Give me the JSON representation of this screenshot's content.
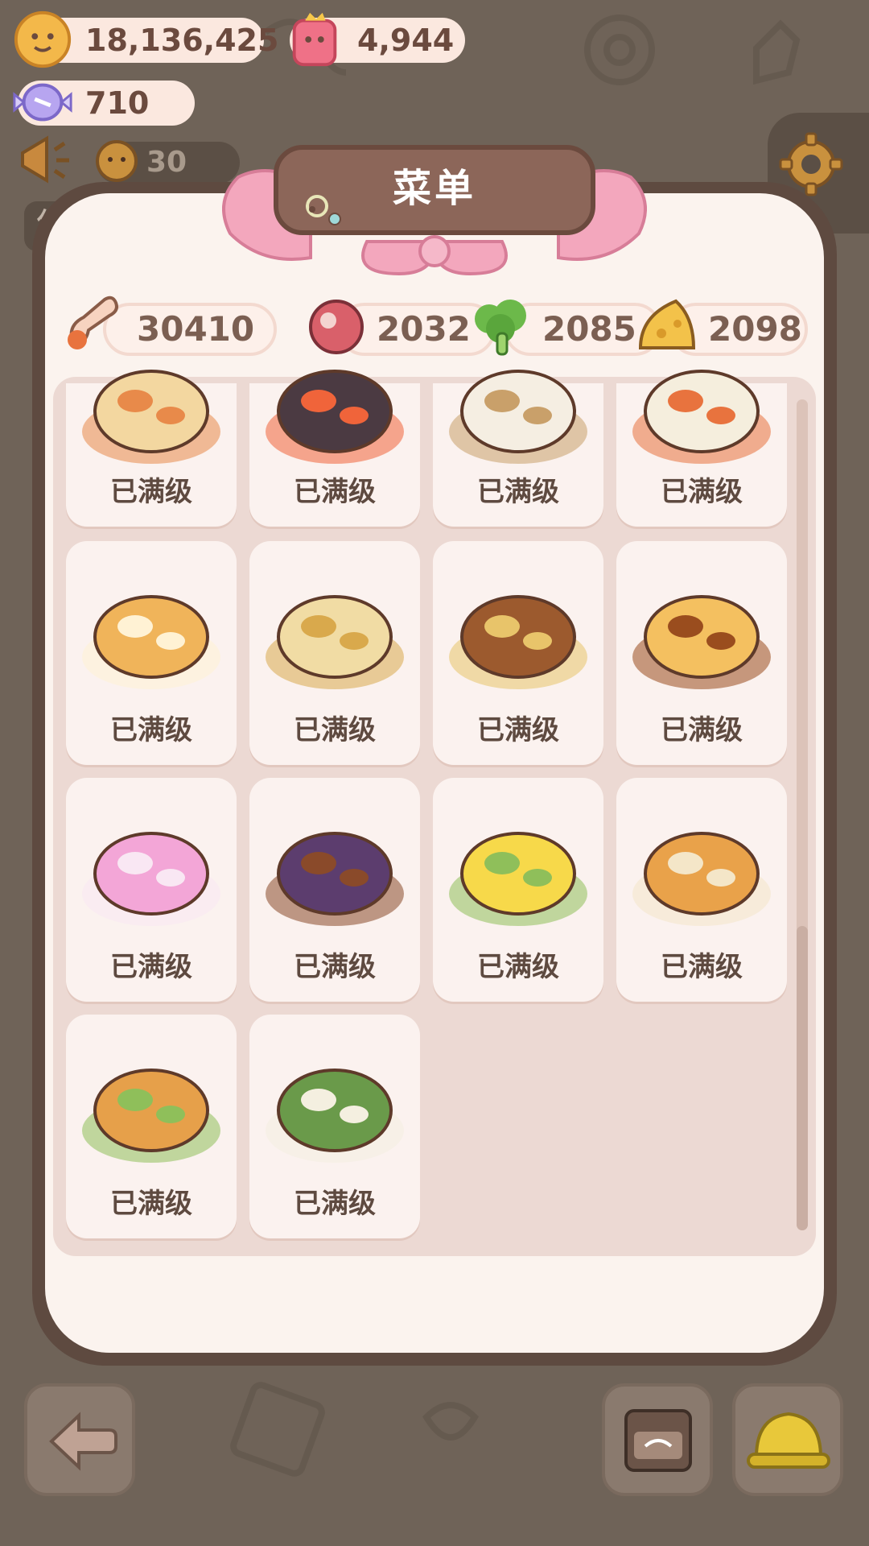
{
  "currency": {
    "coins": "18,136,425",
    "gems": "4,944",
    "candy": "710",
    "helpers": "30",
    "rest_label": "休"
  },
  "menu": {
    "title": "菜单"
  },
  "resources": {
    "spice": "30410",
    "meat": "2032",
    "vegetable": "2085",
    "cheese": "2098"
  },
  "dishes": [
    {
      "status": "已满级",
      "icon": "noodle-soup-icon"
    },
    {
      "status": "已满级",
      "icon": "roe-sushi-icon"
    },
    {
      "status": "已满级",
      "icon": "rice-bowl-icon"
    },
    {
      "status": "已满级",
      "icon": "vegetable-stew-icon"
    },
    {
      "status": "已满级",
      "icon": "bread-loaf-icon"
    },
    {
      "status": "已满级",
      "icon": "soup-dumpling-icon"
    },
    {
      "status": "已满级",
      "icon": "takoyaki-icon"
    },
    {
      "status": "已满级",
      "icon": "pudding-icon"
    },
    {
      "status": "已满级",
      "icon": "rainbow-ice-cream-icon"
    },
    {
      "status": "已满级",
      "icon": "grilled-eel-icon"
    },
    {
      "status": "已满级",
      "icon": "eggs-benedict-icon"
    },
    {
      "status": "已满级",
      "icon": "lattice-pie-icon"
    },
    {
      "status": "已满级",
      "icon": "chicken-skewers-icon"
    },
    {
      "status": "已满级",
      "icon": "zongzi-icon"
    }
  ],
  "colors": {
    "background": "#6f6358",
    "panel_border": "#5e4a40",
    "panel_fill": "#fbf3ee",
    "ribbon": "#f3a7bd",
    "card": "#fbf2ef",
    "text": "#5e4a40"
  }
}
